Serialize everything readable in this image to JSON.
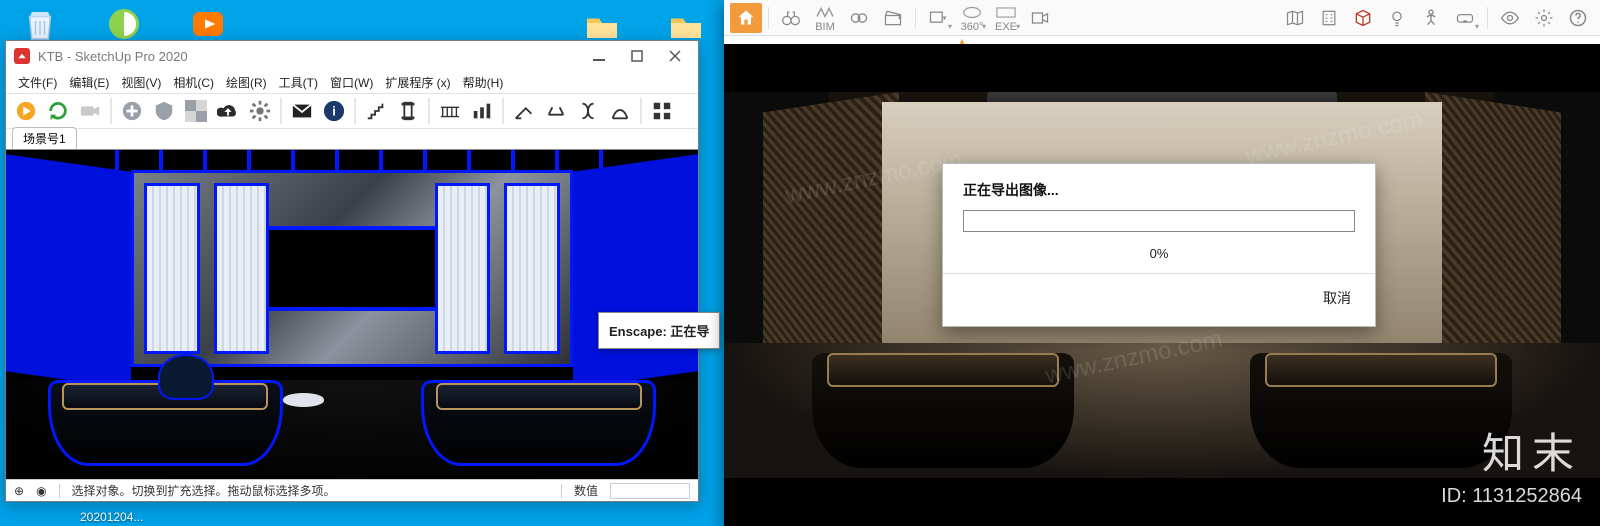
{
  "desktop": {
    "file_label": "20201204..."
  },
  "sketchup": {
    "title": "KTB - SketchUp Pro 2020",
    "menu": [
      "文件(F)",
      "编辑(E)",
      "视图(V)",
      "相机(C)",
      "绘图(R)",
      "工具(T)",
      "窗口(W)",
      "扩展程序 (x)",
      "帮助(H)"
    ],
    "scene_tab": "场景号1",
    "status_help": "选择对象。切换到扩充选择。拖动鼠标选择多项。",
    "status_value_label": "数值",
    "status_value": ""
  },
  "enscape_popup": {
    "label_prefix": "Enscape:",
    "label_rest": " 正在导"
  },
  "enscape": {
    "bim_label": "BIM",
    "deg_label": "360°",
    "exe_label": "EXE"
  },
  "export_dialog": {
    "title": "正在导出图像...",
    "percent": "0%",
    "cancel": "取消"
  },
  "watermark": {
    "brand": "知末",
    "id_label": "ID: 1131252864",
    "url": "www.znzmo.com"
  }
}
